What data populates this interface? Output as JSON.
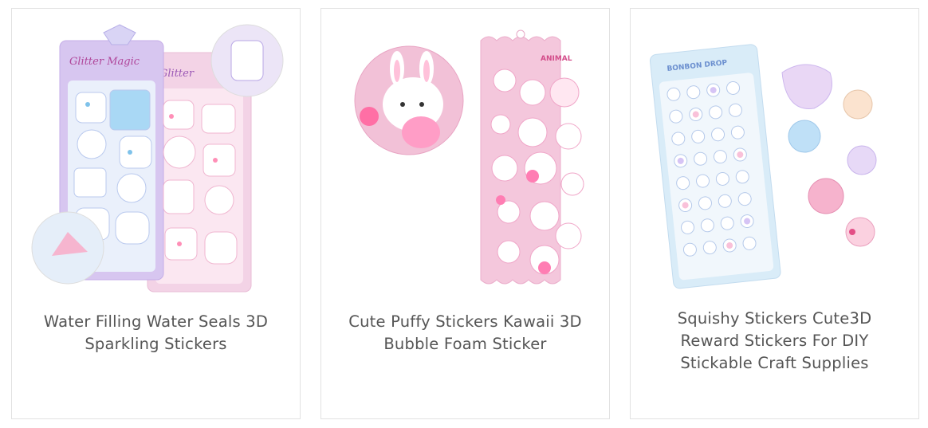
{
  "products": [
    {
      "title": "Water Filling Water Seals 3D Sparkling Stickers",
      "image_alt": "water-seal-sticker-sheets"
    },
    {
      "title": "Cute Puffy Stickers Kawaii 3D Bubble Foam Sticker",
      "image_alt": "puffy-bunny-sticker-sheet"
    },
    {
      "title": "Squishy Stickers Cute3D Reward Stickers For DIY Stickable Craft Supplies",
      "image_alt": "squishy-sticker-sheet"
    }
  ],
  "colors": {
    "card_border": "#e2e2e2",
    "title_text": "#555555",
    "pink": "#f7b6d2",
    "lavender": "#cdb8f0",
    "sky": "#bfe3f7"
  }
}
